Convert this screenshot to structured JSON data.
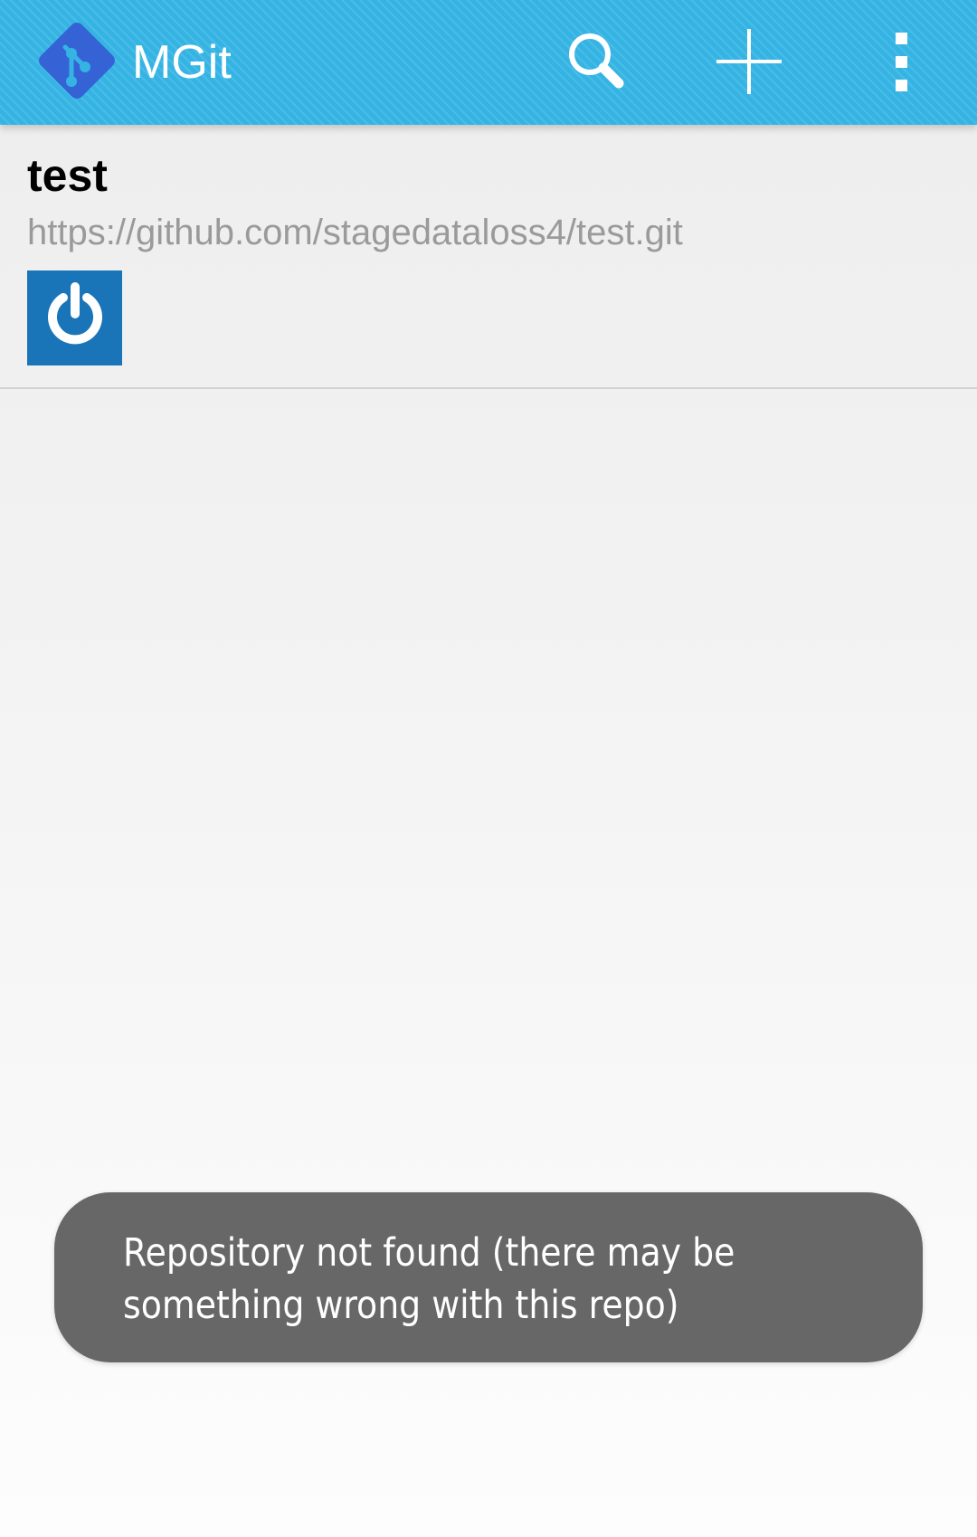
{
  "action_bar": {
    "app_title": "MGit",
    "logo_icon": "git-diamond-logo-icon",
    "search_icon": "search-icon",
    "add_icon": "plus-icon",
    "more_icon": "more-vertical-icon",
    "background_color": "#35b4e4"
  },
  "repositories": [
    {
      "name": "test",
      "url": "https://github.com/stagedataloss4/test.git",
      "status_icon": "power-icon",
      "status_color": "#1a74b8"
    }
  ],
  "toast": {
    "message": "Repository not found (there may be something wrong with this repo)"
  }
}
